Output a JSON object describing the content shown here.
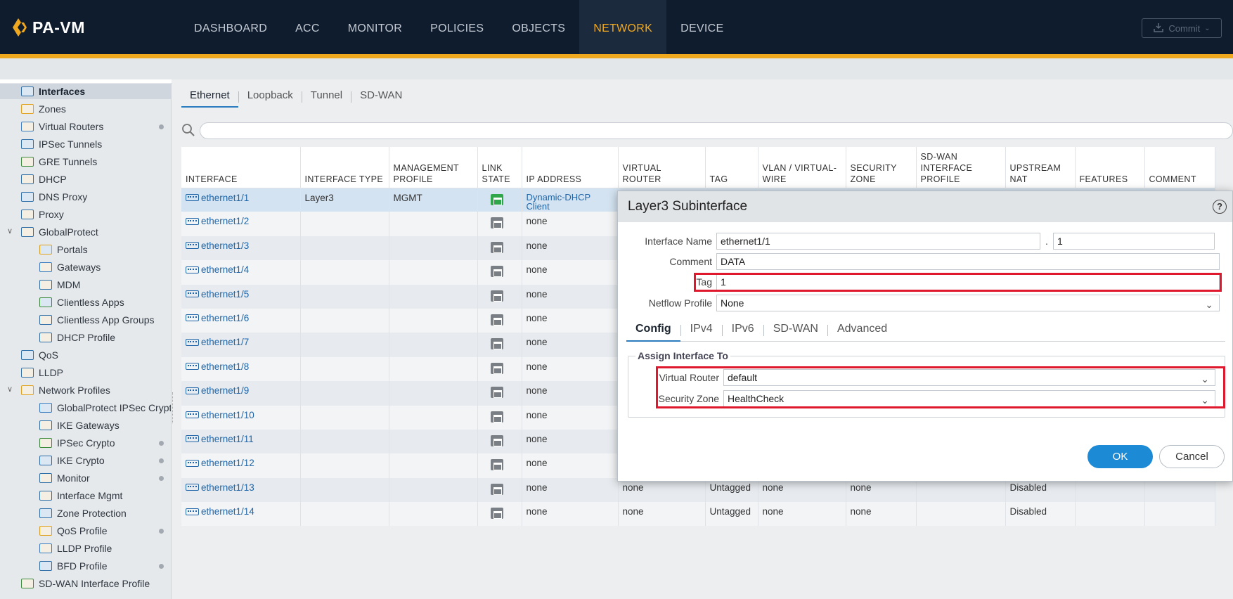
{
  "app": {
    "logo_text": "PA-VM",
    "nav": [
      {
        "label": "DASHBOARD",
        "active": false
      },
      {
        "label": "ACC",
        "active": false
      },
      {
        "label": "MONITOR",
        "active": false
      },
      {
        "label": "POLICIES",
        "active": false
      },
      {
        "label": "OBJECTS",
        "active": false
      },
      {
        "label": "NETWORK",
        "active": true
      },
      {
        "label": "DEVICE",
        "active": false
      }
    ],
    "commit_label": "Commit",
    "colors": {
      "nav_bg": "#0f1c2e",
      "accent": "#f0a91e",
      "link": "#2066a8",
      "highlight": "#e0182d",
      "primary_button": "#1d8ad6"
    }
  },
  "sidebar": {
    "items": [
      {
        "label": "Interfaces",
        "icon": "interfaces-icon",
        "selected": true,
        "dot": false
      },
      {
        "label": "Zones",
        "icon": "zones-icon",
        "dot": false
      },
      {
        "label": "Virtual Routers",
        "icon": "virtual-routers-icon",
        "dot": true
      },
      {
        "label": "IPSec Tunnels",
        "icon": "ipsec-tunnels-icon",
        "dot": false
      },
      {
        "label": "GRE Tunnels",
        "icon": "gre-tunnels-icon",
        "dot": false
      },
      {
        "label": "DHCP",
        "icon": "dhcp-icon",
        "dot": false
      },
      {
        "label": "DNS Proxy",
        "icon": "dns-proxy-icon",
        "dot": false
      },
      {
        "label": "Proxy",
        "icon": "proxy-icon",
        "dot": false
      },
      {
        "label": "GlobalProtect",
        "icon": "globalprotect-icon",
        "expanded": true,
        "dot": false
      },
      {
        "label": "Portals",
        "icon": "portals-icon",
        "indent": 1,
        "dot": false
      },
      {
        "label": "Gateways",
        "icon": "gateways-icon",
        "indent": 1,
        "dot": false
      },
      {
        "label": "MDM",
        "icon": "mdm-icon",
        "indent": 1,
        "dot": false
      },
      {
        "label": "Clientless Apps",
        "icon": "clientless-apps-icon",
        "indent": 1,
        "dot": false
      },
      {
        "label": "Clientless App Groups",
        "icon": "clientless-app-groups-icon",
        "indent": 1,
        "dot": false
      },
      {
        "label": "DHCP Profile",
        "icon": "dhcp-profile-icon",
        "indent": 1,
        "dot": false
      },
      {
        "label": "QoS",
        "icon": "qos-icon",
        "dot": false
      },
      {
        "label": "LLDP",
        "icon": "lldp-icon",
        "dot": false
      },
      {
        "label": "Network Profiles",
        "icon": "network-profiles-icon",
        "expanded": true,
        "dot": false
      },
      {
        "label": "GlobalProtect IPSec Crypto",
        "icon": "lock-icon",
        "indent": 1,
        "dot": false
      },
      {
        "label": "IKE Gateways",
        "icon": "ike-gateways-icon",
        "indent": 1,
        "dot": false
      },
      {
        "label": "IPSec Crypto",
        "icon": "lock-icon",
        "indent": 1,
        "dot": true
      },
      {
        "label": "IKE Crypto",
        "icon": "lock-icon",
        "indent": 1,
        "dot": true
      },
      {
        "label": "Monitor",
        "icon": "monitor-icon",
        "indent": 1,
        "dot": true
      },
      {
        "label": "Interface Mgmt",
        "icon": "interface-mgmt-icon",
        "indent": 1,
        "dot": false
      },
      {
        "label": "Zone Protection",
        "icon": "zone-protection-icon",
        "indent": 1,
        "dot": false
      },
      {
        "label": "QoS Profile",
        "icon": "qos-profile-icon",
        "indent": 1,
        "dot": true
      },
      {
        "label": "LLDP Profile",
        "icon": "lldp-profile-icon",
        "indent": 1,
        "dot": false
      },
      {
        "label": "BFD Profile",
        "icon": "bfd-profile-icon",
        "indent": 1,
        "dot": true
      },
      {
        "label": "SD-WAN Interface Profile",
        "icon": "sdwan-profile-icon",
        "dot": false
      }
    ]
  },
  "tabs": [
    {
      "label": "Ethernet",
      "active": true
    },
    {
      "label": "Loopback",
      "active": false
    },
    {
      "label": "Tunnel",
      "active": false
    },
    {
      "label": "SD-WAN",
      "active": false
    }
  ],
  "table": {
    "columns": [
      "INTERFACE",
      "INTERFACE TYPE",
      "MANAGEMENT PROFILE",
      "LINK STATE",
      "IP ADDRESS",
      "VIRTUAL ROUTER",
      "TAG",
      "VLAN / VIRTUAL-WIRE",
      "SECURITY ZONE",
      "SD-WAN INTERFACE PROFILE",
      "UPSTREAM NAT",
      "FEATURES",
      "COMMENT"
    ],
    "rows": [
      {
        "interface": "ethernet1/1",
        "type": "Layer3",
        "mgmt": "MGMT",
        "link": "up",
        "ip": "Dynamic-DHCP Client",
        "vr": "",
        "tag": "",
        "vlan": "",
        "zone": "",
        "sdwan": "",
        "nat": "",
        "features": "",
        "comment": ""
      },
      {
        "interface": "ethernet1/2",
        "type": "",
        "mgmt": "",
        "link": "down",
        "ip": "none",
        "vr": "",
        "tag": "",
        "vlan": "",
        "zone": "",
        "sdwan": "",
        "nat": "",
        "features": "",
        "comment": ""
      },
      {
        "interface": "ethernet1/3",
        "type": "",
        "mgmt": "",
        "link": "down",
        "ip": "none",
        "vr": "",
        "tag": "",
        "vlan": "",
        "zone": "",
        "sdwan": "",
        "nat": "",
        "features": "",
        "comment": ""
      },
      {
        "interface": "ethernet1/4",
        "type": "",
        "mgmt": "",
        "link": "down",
        "ip": "none",
        "vr": "",
        "tag": "",
        "vlan": "",
        "zone": "",
        "sdwan": "",
        "nat": "",
        "features": "",
        "comment": ""
      },
      {
        "interface": "ethernet1/5",
        "type": "",
        "mgmt": "",
        "link": "down",
        "ip": "none",
        "vr": "",
        "tag": "",
        "vlan": "",
        "zone": "",
        "sdwan": "",
        "nat": "",
        "features": "",
        "comment": ""
      },
      {
        "interface": "ethernet1/6",
        "type": "",
        "mgmt": "",
        "link": "down",
        "ip": "none",
        "vr": "",
        "tag": "",
        "vlan": "",
        "zone": "",
        "sdwan": "",
        "nat": "",
        "features": "",
        "comment": ""
      },
      {
        "interface": "ethernet1/7",
        "type": "",
        "mgmt": "",
        "link": "down",
        "ip": "none",
        "vr": "",
        "tag": "",
        "vlan": "",
        "zone": "",
        "sdwan": "",
        "nat": "",
        "features": "",
        "comment": ""
      },
      {
        "interface": "ethernet1/8",
        "type": "",
        "mgmt": "",
        "link": "down",
        "ip": "none",
        "vr": "",
        "tag": "",
        "vlan": "",
        "zone": "",
        "sdwan": "",
        "nat": "",
        "features": "",
        "comment": ""
      },
      {
        "interface": "ethernet1/9",
        "type": "",
        "mgmt": "",
        "link": "down",
        "ip": "none",
        "vr": "",
        "tag": "",
        "vlan": "",
        "zone": "",
        "sdwan": "",
        "nat": "",
        "features": "",
        "comment": ""
      },
      {
        "interface": "ethernet1/10",
        "type": "",
        "mgmt": "",
        "link": "down",
        "ip": "none",
        "vr": "",
        "tag": "",
        "vlan": "",
        "zone": "",
        "sdwan": "",
        "nat": "",
        "features": "",
        "comment": ""
      },
      {
        "interface": "ethernet1/11",
        "type": "",
        "mgmt": "",
        "link": "down",
        "ip": "none",
        "vr": "",
        "tag": "",
        "vlan": "",
        "zone": "",
        "sdwan": "",
        "nat": "",
        "features": "",
        "comment": ""
      },
      {
        "interface": "ethernet1/12",
        "type": "",
        "mgmt": "",
        "link": "down",
        "ip": "none",
        "vr": "",
        "tag": "",
        "vlan": "",
        "zone": "",
        "sdwan": "",
        "nat": "",
        "features": "",
        "comment": ""
      },
      {
        "interface": "ethernet1/13",
        "type": "",
        "mgmt": "",
        "link": "down",
        "ip": "none",
        "vr": "none",
        "tag": "Untagged",
        "vlan": "none",
        "zone": "none",
        "sdwan": "",
        "nat": "Disabled",
        "features": "",
        "comment": ""
      },
      {
        "interface": "ethernet1/14",
        "type": "",
        "mgmt": "",
        "link": "down",
        "ip": "none",
        "vr": "none",
        "tag": "Untagged",
        "vlan": "none",
        "zone": "none",
        "sdwan": "",
        "nat": "Disabled",
        "features": "",
        "comment": ""
      }
    ]
  },
  "dialog": {
    "title": "Layer3 Subinterface",
    "help_label": "?",
    "interface_name": {
      "label": "Interface Name",
      "value": "ethernet1/1",
      "separator": ".",
      "subnum": "1"
    },
    "comment": {
      "label": "Comment",
      "value": "DATA"
    },
    "tag": {
      "label": "Tag",
      "value": "1"
    },
    "netflow": {
      "label": "Netflow Profile",
      "value": "None"
    },
    "tabs": [
      {
        "label": "Config",
        "active": true
      },
      {
        "label": "IPv4",
        "active": false
      },
      {
        "label": "IPv6",
        "active": false
      },
      {
        "label": "SD-WAN",
        "active": false
      },
      {
        "label": "Advanced",
        "active": false
      }
    ],
    "assign_legend": "Assign Interface To",
    "virtual_router": {
      "label": "Virtual Router",
      "value": "default"
    },
    "security_zone": {
      "label": "Security Zone",
      "value": "HealthCheck"
    },
    "ok_label": "OK",
    "cancel_label": "Cancel"
  }
}
